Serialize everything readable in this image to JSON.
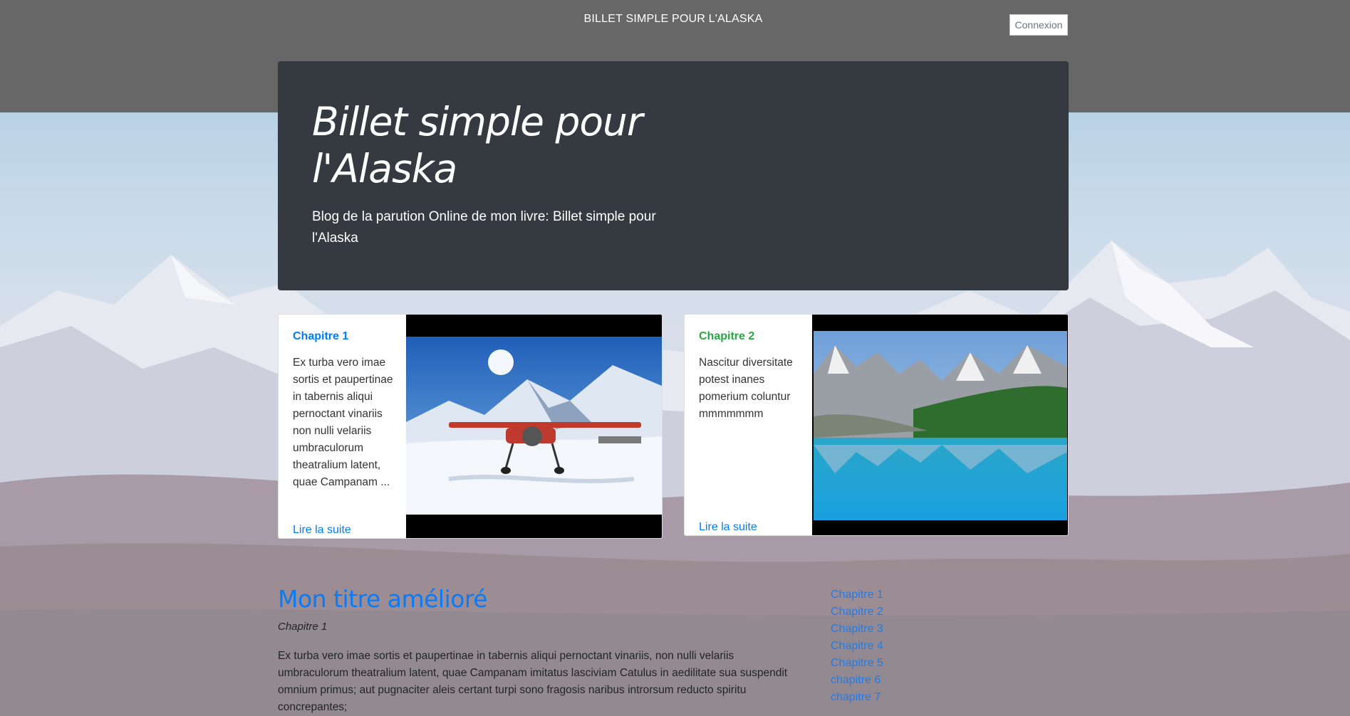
{
  "header": {
    "site_title": "BILLET SIMPLE POUR L'ALASKA",
    "login_label": "Connexion"
  },
  "jumbotron": {
    "title": "Billet simple pour l'Alaska",
    "subtitle": "Blog de la parution Online de mon livre: Billet simple pour l'Alaska"
  },
  "cards": [
    {
      "title": "Chapitre 1",
      "excerpt": "Ex turba vero imae sortis et paupertinae in tabernis aliqui pernoctant vinariis non nulli velariis umbraculorum theatralium latent, quae Campanam ...",
      "link_label": "Lire la suite"
    },
    {
      "title": "Chapitre 2",
      "excerpt": "Nascitur diversitate potest inanes pomerium coluntur mmmmmmm",
      "link_label": "Lire la suite"
    }
  ],
  "post": {
    "title": "Mon titre amélioré",
    "chapter": "Chapitre 1",
    "body": "Ex turba vero imae sortis et paupertinae in tabernis aliqui pernoctant vinariis, non nulli velariis umbraculorum theatralium latent, quae Campanam imitatus lasciviam Catulus in aedilitate sua suspendit omnium primus; aut pugnaciter aleis certant turpi sono fragosis naribus introrsum reducto spiritu concrepantes;"
  },
  "chapter_nav": [
    "Chapitre 1",
    "Chapitre 2",
    "Chapitre 3",
    "Chapitre 4",
    "Chapitre 5",
    "chapitre 6",
    "chapitre 7"
  ],
  "colors": {
    "header_band": "#676767",
    "jumbotron_bg": "#343a40",
    "link_blue": "#007bff",
    "card2_title_green": "#28a745"
  }
}
